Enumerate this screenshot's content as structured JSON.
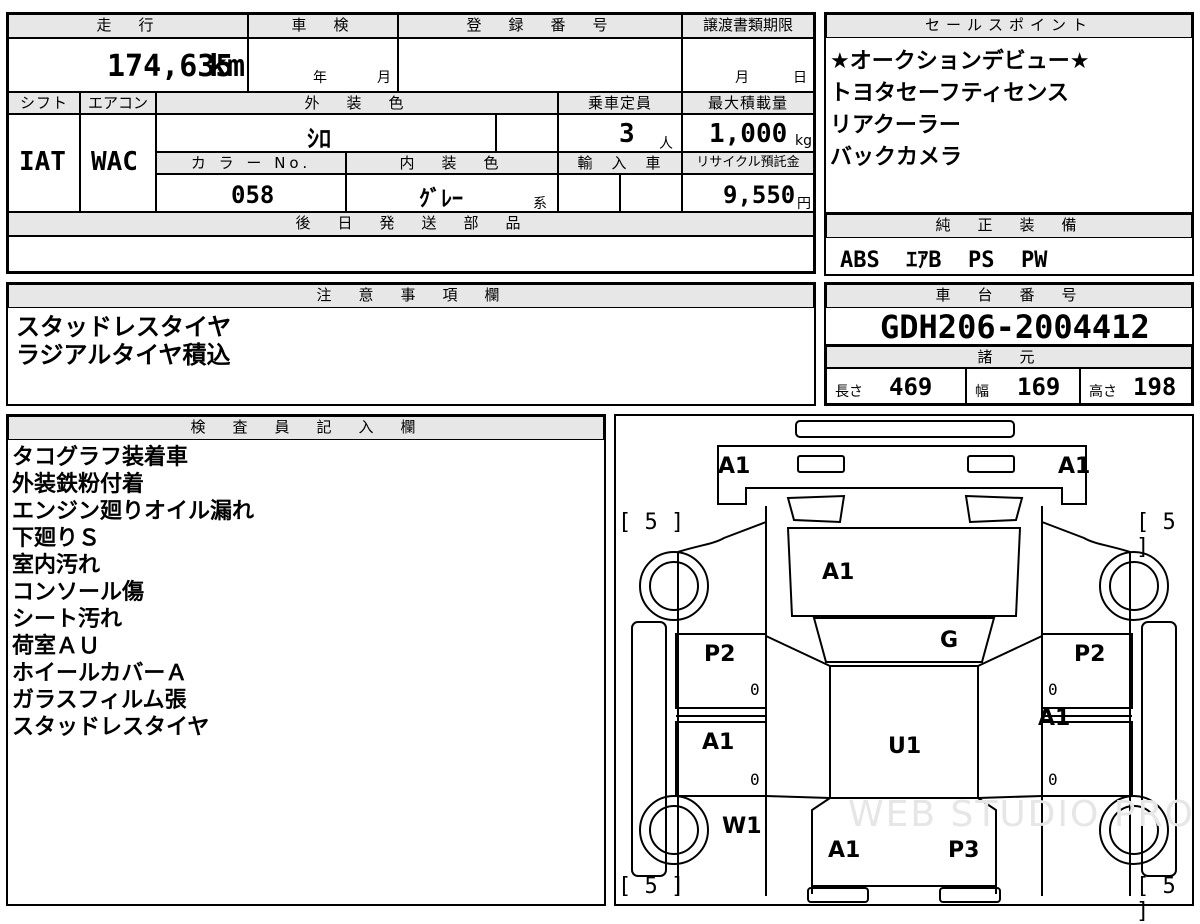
{
  "vehicle": {
    "headers": {
      "mileage": "走　行",
      "inspection": "車　検",
      "registration": "登　録　番　号",
      "transfer_deadline": "譲渡書類期限",
      "shift": "シフト",
      "aircon": "エアコン",
      "exterior_color": "外　装　色",
      "capacity": "乗車定員",
      "max_load": "最大積載量",
      "color_no": "カ ラ ー No.",
      "interior_color": "内　装　色",
      "import": "輸　入　車",
      "recycle_fee": "リサイクル預託金",
      "later_parts": "後　日　発　送　部　品"
    },
    "mileage_value": "174,635",
    "mileage_unit": "km",
    "inspection_year": "年",
    "inspection_month": "月",
    "registration_value": "",
    "deadline_month": "月",
    "deadline_day": "日",
    "shift_value": "IAT",
    "aircon_value": "WAC",
    "exterior_color_value": "ｼﾛ",
    "capacity_value": "3",
    "capacity_unit": "人",
    "max_load_value": "1,000",
    "max_load_unit": "kg",
    "color_no_value": "058",
    "interior_color_value": "ｸﾞﾚｰ",
    "interior_suffix": "系",
    "recycle_value": "9,550",
    "recycle_unit": "円",
    "later_parts_value": ""
  },
  "sales_points": {
    "header": "セールスポイント",
    "items": [
      "★オークションデビュー★",
      "トヨタセーフティセンス",
      "リアクーラー",
      "バックカメラ"
    ]
  },
  "genuine_equipment": {
    "header": "純　正　装　備",
    "value": "ABS  ｴｱB  PS  PW"
  },
  "notes": {
    "header": "注　意　事　項　欄",
    "items": [
      "スタッドレスタイヤ",
      "ラジアルタイヤ積込"
    ]
  },
  "chassis": {
    "header": "車　台　番　号",
    "value": "GDH206-2004412"
  },
  "specs": {
    "header": "諸　元",
    "length_label": "長さ",
    "length_value": "469",
    "width_label": "幅",
    "width_value": "169",
    "height_label": "高さ",
    "height_value": "198"
  },
  "inspector": {
    "header": "検　査　員　記　入　欄",
    "items": [
      "タコグラフ装着車",
      "外装鉄粉付着",
      "エンジン廻りオイル漏れ",
      "下廻りＳ",
      "室内汚れ",
      "コンソール傷",
      "シート汚れ",
      "荷室ＡＵ",
      "ホイールカバーＡ",
      "ガラスフィルム張",
      "スタッドレスタイヤ"
    ]
  },
  "diagram": {
    "marks": {
      "front_left": "A1",
      "front_right": "A1",
      "hood": "A1",
      "windshield": "G",
      "front_door_left": "P2",
      "front_door_right": "P2",
      "rear_door_left": "A1",
      "rear_door_right": "A1",
      "roof": "U1",
      "rear_wheel_left": "W1",
      "rear_quarter": "A1",
      "rear_gate": "P3"
    },
    "tire_front_left": "[ 5 ]",
    "tire_front_right": "[ 5 ]",
    "tire_rear_left": "[ 5 ]",
    "tire_rear_right": "[ 5 ]",
    "zero_label": "0",
    "watermark": "WEB STUDIO PRO"
  }
}
